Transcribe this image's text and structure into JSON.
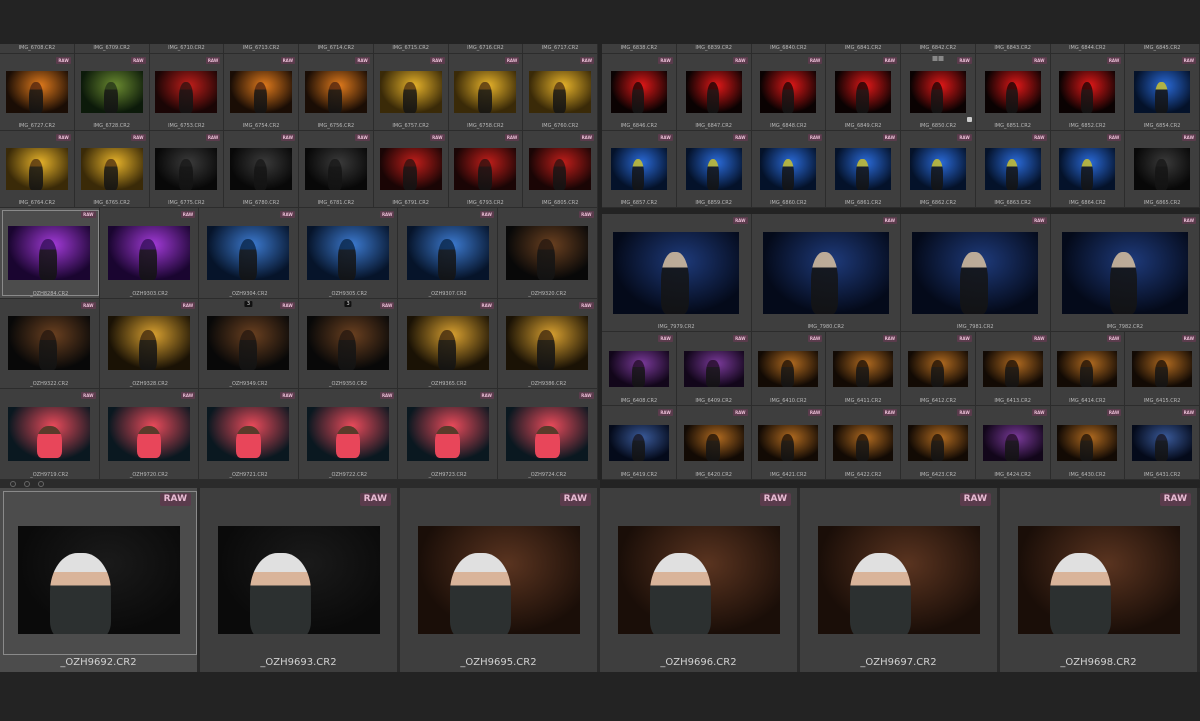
{
  "colors": {
    "background": "#232323",
    "cell": "#3e3e3e",
    "raw_badge_bg": "#5a3b4c",
    "raw_badge_fg": "#e9bcd4"
  },
  "raw_label": "RAW",
  "top_left": {
    "header_names": [
      "IMG_6708.CR2",
      "IMG_6709.CR2",
      "IMG_6710.CR2",
      "IMG_6713.CR2",
      "IMG_6714.CR2",
      "IMG_6715.CR2",
      "IMG_6716.CR2",
      "IMG_6717.CR2"
    ],
    "row1": [
      {
        "name": "IMG_6727.CR2",
        "tone": "stage-orange"
      },
      {
        "name": "IMG_6728.CR2",
        "tone": "stage-green"
      },
      {
        "name": "IMG_6753.CR2",
        "tone": "stage-red"
      },
      {
        "name": "IMG_6754.CR2",
        "tone": "stage-orange"
      },
      {
        "name": "IMG_6756.CR2",
        "tone": "stage-orange"
      },
      {
        "name": "IMG_6757.CR2",
        "tone": "stage-yellow"
      },
      {
        "name": "IMG_6758.CR2",
        "tone": "stage-yellow"
      },
      {
        "name": "IMG_6760.CR2",
        "tone": "stage-yellow"
      }
    ],
    "row2": [
      {
        "name": "IMG_6764.CR2",
        "tone": "stage-yellow"
      },
      {
        "name": "IMG_6765.CR2",
        "tone": "stage-yellow"
      },
      {
        "name": "IMG_6775.CR2",
        "tone": "stage-dark"
      },
      {
        "name": "IMG_6780.CR2",
        "tone": "stage-dark"
      },
      {
        "name": "IMG_6781.CR2",
        "tone": "stage-dark"
      },
      {
        "name": "IMG_6791.CR2",
        "tone": "stage-red"
      },
      {
        "name": "IMG_6793.CR2",
        "tone": "stage-red"
      },
      {
        "name": "IMG_6805.CR2",
        "tone": "stage-red"
      }
    ]
  },
  "drums": {
    "rows": [
      [
        {
          "name": "_OZH8284.CR2",
          "tone": "drum-purple",
          "selected": true
        },
        {
          "name": "_OZH9303.CR2",
          "tone": "drum-purple"
        },
        {
          "name": "_OZH9304.CR2",
          "tone": "drum-blue"
        },
        {
          "name": "_OZH9305.CR2",
          "tone": "drum-blue"
        },
        {
          "name": "_OZH9307.CR2",
          "tone": "drum-blue"
        },
        {
          "name": "_OZH9320.CR2",
          "tone": "drum-dark"
        }
      ],
      [
        {
          "name": "_OZH9322.CR2",
          "tone": "drum-dark"
        },
        {
          "name": "_OZH9328.CR2",
          "tone": "drum-yellow"
        },
        {
          "name": "_OZH9349.CR2",
          "tone": "drum-dark",
          "badge": "3"
        },
        {
          "name": "_OZH9350.CR2",
          "tone": "drum-dark",
          "badge": "3"
        },
        {
          "name": "_OZH9365.CR2",
          "tone": "drum-yellow"
        },
        {
          "name": "_OZH9386.CR2",
          "tone": "drum-yellow"
        }
      ],
      [
        {
          "name": "_OZH9719.CR2",
          "tone": "drum-cyan"
        },
        {
          "name": "_OZH9720.CR2",
          "tone": "drum-cyan"
        },
        {
          "name": "_OZH9721.CR2",
          "tone": "drum-cyan"
        },
        {
          "name": "_OZH9722.CR2",
          "tone": "drum-cyan"
        },
        {
          "name": "_OZH9723.CR2",
          "tone": "drum-cyan"
        },
        {
          "name": "_OZH9724.CR2",
          "tone": "drum-cyan"
        }
      ]
    ]
  },
  "top_right": {
    "header_names": [
      "IMG_6838.CR2",
      "IMG_6839.CR2",
      "IMG_6840.CR2",
      "IMG_6841.CR2",
      "IMG_6842.CR2",
      "IMG_6843.CR2",
      "IMG_6844.CR2",
      "IMG_6845.CR2"
    ],
    "row1": [
      {
        "name": "IMG_6846.CR2",
        "tone": "guitar-red"
      },
      {
        "name": "IMG_6847.CR2",
        "tone": "guitar-red"
      },
      {
        "name": "IMG_6848.CR2",
        "tone": "guitar-red"
      },
      {
        "name": "IMG_6849.CR2",
        "tone": "guitar-red"
      },
      {
        "name": "IMG_6850.CR2",
        "tone": "guitar-red",
        "icons": true,
        "flag": true
      },
      {
        "name": "IMG_6851.CR2",
        "tone": "guitar-red"
      },
      {
        "name": "IMG_6852.CR2",
        "tone": "guitar-red"
      },
      {
        "name": "IMG_6854.CR2",
        "tone": "guitar-blue"
      }
    ],
    "row2": [
      {
        "name": "IMG_6857.CR2",
        "tone": "guitar-blue"
      },
      {
        "name": "IMG_6859.CR2",
        "tone": "guitar-blue"
      },
      {
        "name": "IMG_6860.CR2",
        "tone": "guitar-blue"
      },
      {
        "name": "IMG_6861.CR2",
        "tone": "guitar-blue"
      },
      {
        "name": "IMG_6862.CR2",
        "tone": "guitar-blue"
      },
      {
        "name": "IMG_6863.CR2",
        "tone": "guitar-blue"
      },
      {
        "name": "IMG_6864.CR2",
        "tone": "guitar-blue"
      },
      {
        "name": "IMG_6865.CR2",
        "tone": "stage-dark"
      }
    ]
  },
  "singers": [
    {
      "name": "IMG_7979.CR2",
      "tone": "singer-blue"
    },
    {
      "name": "IMG_7980.CR2",
      "tone": "singer-blue"
    },
    {
      "name": "IMG_7981.CR2",
      "tone": "singer-blue"
    },
    {
      "name": "IMG_7982.CR2",
      "tone": "singer-blue"
    }
  ],
  "wide": {
    "row1": [
      {
        "name": "IMG_6408.CR2",
        "tone": "wide-purple"
      },
      {
        "name": "IMG_6409.CR2",
        "tone": "wide-purple"
      },
      {
        "name": "IMG_6410.CR2",
        "tone": "wide-warm"
      },
      {
        "name": "IMG_6411.CR2",
        "tone": "wide-warm"
      },
      {
        "name": "IMG_6412.CR2",
        "tone": "wide-warm"
      },
      {
        "name": "IMG_6413.CR2",
        "tone": "wide-warm"
      },
      {
        "name": "IMG_6414.CR2",
        "tone": "wide-warm"
      },
      {
        "name": "IMG_6415.CR2",
        "tone": "wide-warm"
      }
    ],
    "row2": [
      {
        "name": "IMG_6419.CR2",
        "tone": "wide-blue"
      },
      {
        "name": "IMG_6420.CR2",
        "tone": "wide-warm"
      },
      {
        "name": "IMG_6421.CR2",
        "tone": "wide-warm"
      },
      {
        "name": "IMG_6422.CR2",
        "tone": "wide-warm"
      },
      {
        "name": "IMG_6423.CR2",
        "tone": "wide-warm"
      },
      {
        "name": "IMG_6424.CR2",
        "tone": "wide-purple"
      },
      {
        "name": "IMG_6430.CR2",
        "tone": "wide-warm"
      },
      {
        "name": "IMG_6431.CR2",
        "tone": "wide-blue"
      }
    ]
  },
  "bottom": [
    {
      "name": "_OZH9692.CR2",
      "tone": "portrait-dark",
      "selected": true
    },
    {
      "name": "_OZH9693.CR2",
      "tone": "portrait-dark"
    },
    {
      "name": "_OZH9695.CR2",
      "tone": "portrait-warm"
    },
    {
      "name": "_OZH9696.CR2",
      "tone": "portrait-warm"
    },
    {
      "name": "_OZH9697.CR2",
      "tone": "portrait-warm"
    },
    {
      "name": "_OZH9698.CR2",
      "tone": "portrait-warm"
    }
  ]
}
